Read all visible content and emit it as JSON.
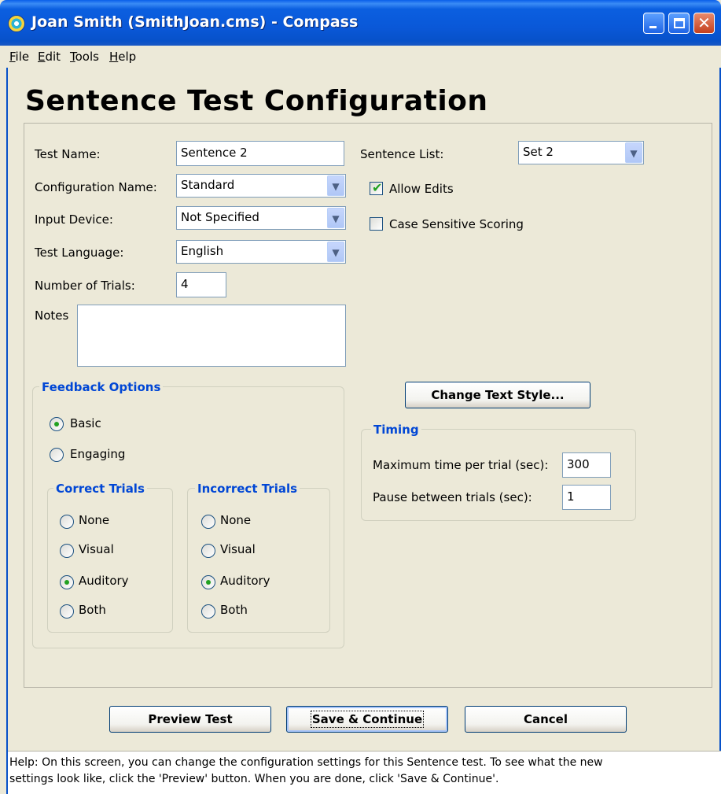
{
  "window": {
    "title": "Joan Smith (SmithJoan.cms) - Compass",
    "minimize_icon": "minimize-icon",
    "maximize_icon": "maximize-icon",
    "close_icon": "close-icon",
    "close_glyph": "✕"
  },
  "menu": {
    "items": [
      {
        "key": "F",
        "rest": "ile"
      },
      {
        "key": "E",
        "rest": "dit"
      },
      {
        "key": "T",
        "rest": "ools"
      },
      {
        "key": "H",
        "rest": "elp"
      }
    ]
  },
  "page_title": "Sentence Test Configuration",
  "form": {
    "test_name_label": "Test Name:",
    "test_name_value": "Sentence 2",
    "configuration_name_label": "Configuration Name:",
    "configuration_name_value": "Standard",
    "input_device_label": "Input Device:",
    "input_device_value": "Not Specified",
    "test_language_label": "Test Language:",
    "test_language_value": "English",
    "number_of_trials_label": "Number of Trials:",
    "number_of_trials_value": "4",
    "notes_label": "Notes",
    "notes_value": "",
    "sentence_list_label": "Sentence List:",
    "sentence_list_value": "Set 2",
    "allow_edits_label": "Allow Edits",
    "allow_edits_checked": true,
    "case_sensitive_label": "Case Sensitive Scoring",
    "case_sensitive_checked": false,
    "dropdown_arrow": "▼"
  },
  "feedback": {
    "title": "Feedback Options",
    "basic_label": "Basic",
    "engaging_label": "Engaging",
    "selected": "Basic",
    "correct": {
      "title": "Correct Trials",
      "options": [
        "None",
        "Visual",
        "Auditory",
        "Both"
      ],
      "selected": "Auditory"
    },
    "incorrect": {
      "title": "Incorrect Trials",
      "options": [
        "None",
        "Visual",
        "Auditory",
        "Both"
      ],
      "selected": "Auditory"
    }
  },
  "change_text_style_button": "Change Text Style...",
  "timing": {
    "title": "Timing",
    "max_time_label": "Maximum time per trial (sec):",
    "max_time_value": "300",
    "pause_label": "Pause between trials (sec):",
    "pause_value": "1"
  },
  "buttons": {
    "preview": "Preview Test",
    "save": "Save & Continue",
    "cancel": "Cancel"
  },
  "help": {
    "line1": "Help:  On this screen, you can change the configuration settings for this Sentence test.  To see what the new",
    "line2": "settings look like, click the 'Preview' button.  When you are done, click 'Save & Continue'."
  }
}
